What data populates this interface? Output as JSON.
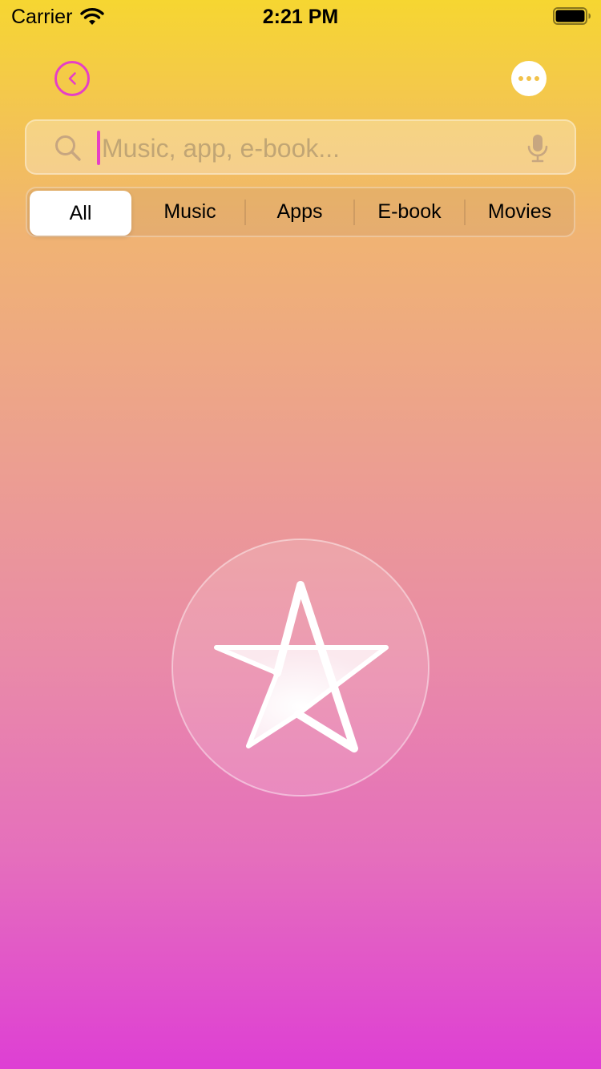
{
  "status_bar": {
    "carrier": "Carrier",
    "time": "2:21 PM",
    "wifi_icon": "wifi-icon",
    "battery_icon": "battery-icon"
  },
  "nav": {
    "back_icon": "chevron-left-circle-icon",
    "more_icon": "ellipsis-icon"
  },
  "search": {
    "placeholder": "Music, app, e-book...",
    "value": "",
    "left_icon": "search-icon",
    "right_icon": "microphone-icon"
  },
  "segments": [
    {
      "label": "All",
      "selected": true
    },
    {
      "label": "Music",
      "selected": false
    },
    {
      "label": "Apps",
      "selected": false
    },
    {
      "label": "E-book",
      "selected": false
    },
    {
      "label": "Movies",
      "selected": false
    }
  ],
  "emblem": {
    "icon": "star-icon"
  },
  "colors": {
    "accent": "#e63fc6",
    "gradient_top": "#f6d631",
    "gradient_bottom": "#de3fd4",
    "more_dot": "#f2c24a"
  }
}
